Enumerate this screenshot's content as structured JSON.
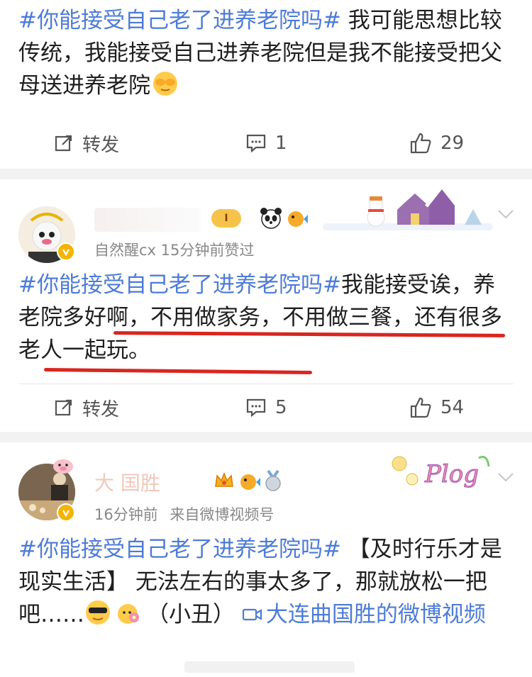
{
  "post1": {
    "topic": "#你能接受自己老了进养老院吗#",
    "text": " 我可能思想比较传统，我能接受自己进养老院但是我不能接受把父母送进养老院",
    "emoji": "face-covering-eyes-emoji",
    "repost_label": "转发",
    "comment_count": "1",
    "like_count": "29"
  },
  "post2": {
    "meta": "自然醒cx 15分钟前赞过",
    "topic": "#你能接受自己老了进养老院吗#",
    "text": "我能接受诶，养老院多好啊，不用做家务，不用做三餐，还有很多老人一起玩。",
    "repost_label": "转发",
    "comment_count": "5",
    "like_count": "54",
    "badges": [
      "level-badge-I",
      "panda-icon",
      "pufferfish-icon",
      "snowman-house-card-decoration"
    ],
    "underline_color": "#d8261f"
  },
  "post3": {
    "username": "大   国胜",
    "meta_time": "16分钟前",
    "meta_source": "来自微博视频号",
    "topic": "#你能接受自己老了进养老院吗#",
    "text_a": " 【及时行乐才是现实生活】 无法左右的事太多了，那就放松一把吧……",
    "emojis": [
      "cool-face-emoji",
      "flower-face-emoji"
    ],
    "text_b": "（小丑） ",
    "video_link": "大连曲国胜的微博视频",
    "badges": [
      "crown-icon",
      "pufferfish-icon",
      "medal-icon",
      "plog-card-decoration"
    ]
  },
  "colors": {
    "accent_blue": "#4d7bd8",
    "verified_badge": "#f4b400",
    "page_gap": "#f2f2f2"
  }
}
